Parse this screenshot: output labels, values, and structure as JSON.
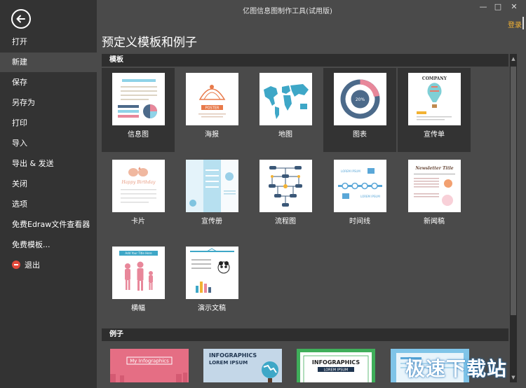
{
  "window": {
    "title": "亿图信息图制作工具(试用版)",
    "login": "登录",
    "controls": {
      "minimize": "—",
      "maximize": "□",
      "close": "✕"
    }
  },
  "sidebar": {
    "items": [
      {
        "label": "打开",
        "active": false
      },
      {
        "label": "新建",
        "active": true
      },
      {
        "label": "保存",
        "active": false
      },
      {
        "label": "另存为",
        "active": false
      },
      {
        "label": "打印",
        "active": false
      },
      {
        "label": "导入",
        "active": false
      },
      {
        "label": "导出 & 发送",
        "active": false
      },
      {
        "label": "关闭",
        "active": false
      },
      {
        "label": "选项",
        "active": false
      },
      {
        "label": "免费Edraw文件查看器",
        "active": false
      },
      {
        "label": "免费模板...",
        "active": false
      },
      {
        "label": "退出",
        "active": false
      }
    ]
  },
  "main": {
    "title": "预定义模板和例子",
    "templates_header": "模板",
    "examples_header": "例子",
    "templates": [
      {
        "label": "信息图"
      },
      {
        "label": "海报"
      },
      {
        "label": "地图"
      },
      {
        "label": "图表"
      },
      {
        "label": "宣传单"
      },
      {
        "label": "卡片"
      },
      {
        "label": "宣传册"
      },
      {
        "label": "流程图"
      },
      {
        "label": "时间线"
      },
      {
        "label": "新闻稿"
      },
      {
        "label": "横幅"
      },
      {
        "label": "演示文稿"
      }
    ],
    "thumb_text": {
      "poster": "POSTER",
      "company": "COMPANY",
      "chart_pct": "20%",
      "newsletter": "Newsletter Title",
      "birthday": "Happy Birthday",
      "banner": "Add Your Title Here",
      "timeline": "LOREM IPSUM"
    },
    "examples": [
      {
        "line1": "My Infographics",
        "line2": ""
      },
      {
        "line1": "INFOGRAPHICS",
        "line2": "LOREM IPSUM"
      },
      {
        "line1": "INFOGRAPHICS",
        "line2": "LOREM IPSUM"
      },
      {
        "line1": "",
        "line2": ""
      }
    ]
  },
  "watermark": "极速下载站",
  "colors": {
    "sidebar": "#333333",
    "content": "#4a4a4a",
    "accent": "#f2b233",
    "exit": "#e2493b"
  }
}
